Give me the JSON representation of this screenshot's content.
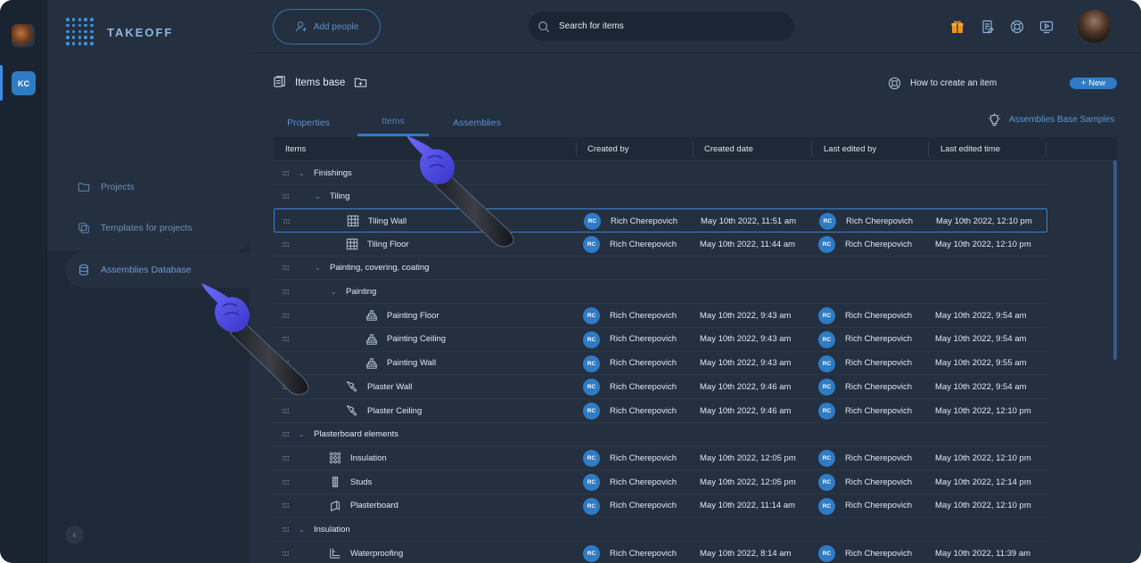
{
  "app": {
    "name": "TAKEOFF",
    "workspace_initials": "KC"
  },
  "sidebar": {
    "items": [
      {
        "label": "Projects",
        "icon": "folder-icon"
      },
      {
        "label": "Templates for projects",
        "icon": "templates-icon"
      },
      {
        "label": "Assemblies Database",
        "icon": "database-icon"
      }
    ]
  },
  "topbar": {
    "add_people": "Add people",
    "search_placeholder": "Search for items"
  },
  "page": {
    "title": "Items base",
    "how_to": "How to create an item",
    "new_button": "+ New",
    "samples": "Assemblies Base Samples",
    "tabs": [
      "Properties",
      "Items",
      "Assemblies"
    ],
    "active_tab": "Items"
  },
  "table": {
    "columns": [
      "Items",
      "Created by",
      "Created date",
      "Last edited by",
      "Last edited time"
    ],
    "rows": [
      {
        "level": 0,
        "group": true,
        "name": "Finishings"
      },
      {
        "level": 1,
        "group": true,
        "name": "Tiling"
      },
      {
        "level": 2,
        "name": "Tiling Wall",
        "icon": "grid-tile-icon",
        "initials": "RC",
        "created_by": "Rich Cherepovich",
        "created": "May 10th 2022, 11:51 am",
        "editor_initials": "RC",
        "edited_by": "Rich Cherepovich",
        "edited": "May 10th 2022, 12:10 pm",
        "selected": true
      },
      {
        "level": 2,
        "name": "Tiling Floor",
        "icon": "grid-tile-icon",
        "initials": "RC",
        "created_by": "Rich Cherepovich",
        "created": "May 10th 2022, 11:44 am",
        "editor_initials": "RC",
        "edited_by": "Rich Cherepovich",
        "edited": "May 10th 2022, 12:10 pm"
      },
      {
        "level": 1,
        "group": true,
        "name": "Painting, covering, coating"
      },
      {
        "level": 2,
        "group": true,
        "name": "Painting"
      },
      {
        "level": 3,
        "name": "Painting Floor",
        "icon": "paint-brush-icon",
        "initials": "RC",
        "created_by": "Rich Cherepovich",
        "created": "May 10th 2022, 9:43 am",
        "editor_initials": "RC",
        "edited_by": "Rich Cherepovich",
        "edited": "May 10th 2022, 9:54 am"
      },
      {
        "level": 3,
        "name": "Painting Ceiling",
        "icon": "paint-brush-icon",
        "initials": "RC",
        "created_by": "Rich Cherepovich",
        "created": "May 10th 2022, 9:43 am",
        "editor_initials": "RC",
        "edited_by": "Rich Cherepovich",
        "edited": "May 10th 2022, 9:54 am"
      },
      {
        "level": 3,
        "name": "Painting Wall",
        "icon": "paint-brush-icon",
        "initials": "RC",
        "created_by": "Rich Cherepovich",
        "created": "May 10th 2022, 9:43 am",
        "editor_initials": "RC",
        "edited_by": "Rich Cherepovich",
        "edited": "May 10th 2022, 9:55 am"
      },
      {
        "level": 2,
        "name": "Plaster Wall",
        "icon": "trowel-icon",
        "initials": "RC",
        "created_by": "Rich Cherepovich",
        "created": "May 10th 2022, 9:46 am",
        "editor_initials": "RC",
        "edited_by": "Rich Cherepovich",
        "edited": "May 10th 2022, 9:54 am"
      },
      {
        "level": 2,
        "name": "Plaster Ceiling",
        "icon": "trowel-icon",
        "initials": "RC",
        "created_by": "Rich Cherepovich",
        "created": "May 10th 2022, 9:46 am",
        "editor_initials": "RC",
        "edited_by": "Rich Cherepovich",
        "edited": "May 10th 2022, 12:10 pm"
      },
      {
        "level": 0,
        "group": true,
        "name": "Plasterboard elements"
      },
      {
        "level": 1,
        "name": "Insulation",
        "icon": "insulation-dots-icon",
        "initials": "RC",
        "created_by": "Rich Cherepovich",
        "created": "May 10th 2022, 12:05 pm",
        "editor_initials": "RC",
        "edited_by": "Rich Cherepovich",
        "edited": "May 10th 2022, 12:10 pm"
      },
      {
        "level": 1,
        "name": "Studs",
        "icon": "stud-icon",
        "initials": "RC",
        "created_by": "Rich Cherepovich",
        "created": "May 10th 2022, 12:05 pm",
        "editor_initials": "RC",
        "edited_by": "Rich Cherepovich",
        "edited": "May 10th 2022, 12:14 pm"
      },
      {
        "level": 1,
        "name": "Plasterboard",
        "icon": "board-icon",
        "initials": "RC",
        "created_by": "Rich Cherepovich",
        "created": "May 10th 2022, 11:14 am",
        "editor_initials": "RC",
        "edited_by": "Rich Cherepovich",
        "edited": "May 10th 2022, 12:10 pm"
      },
      {
        "level": 0,
        "group": true,
        "name": "Insulation"
      },
      {
        "level": 1,
        "name": "Waterproofing",
        "icon": "waterproofing-icon",
        "initials": "RC",
        "created_by": "Rich Cherepovich",
        "created": "May 10th 2022, 8:14 am",
        "editor_initials": "RC",
        "edited_by": "Rich Cherepovich",
        "edited": "May 10th 2022, 11:39 am"
      }
    ]
  },
  "colors": {
    "accent": "#2f7bc5",
    "bg": "#243040",
    "sidebar": "#1e2937"
  }
}
